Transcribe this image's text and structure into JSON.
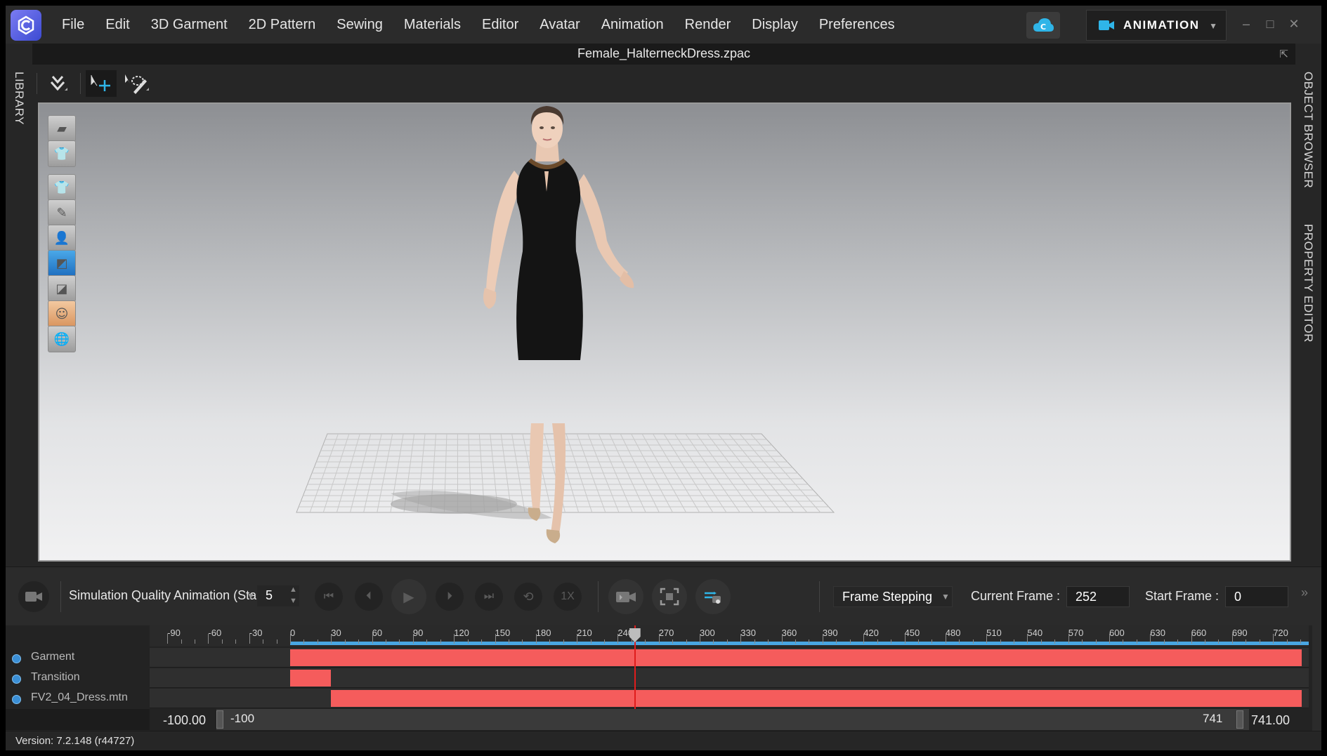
{
  "app": {
    "logo_icon": "clo-logo-icon"
  },
  "menu": [
    "File",
    "Edit",
    "3D Garment",
    "2D Pattern",
    "Sewing",
    "Materials",
    "Editor",
    "Avatar",
    "Animation",
    "Render",
    "Display",
    "Preferences"
  ],
  "mode": {
    "label": "ANIMATION",
    "icon": "video-camera-icon"
  },
  "window": {
    "minimize": "–",
    "maximize": "□",
    "close": "✕"
  },
  "file_title": "Female_HalterneckDress.zpac",
  "side_panels": {
    "left": "LIBRARY",
    "right_top": "OBJECT BROWSER",
    "right_bottom": "PROPERTY EDITOR"
  },
  "toolbar": [
    "import-arrow-icon",
    "select-move-icon",
    "lasso-select-icon"
  ],
  "viewport_tools": [
    "show-3d-garment-icon",
    "show-avatar-garment-icon",
    "show-garment-icon",
    "show-stitch-icon",
    "show-avatar-icon",
    "thickness-icon",
    "texture-icon",
    "avatar-skin-icon",
    "environment-globe-icon"
  ],
  "animation_bar": {
    "sim_quality": "Simulation Quality Animation (Stable",
    "steps_value": "5",
    "frame_mode": "Frame Stepping",
    "current_frame_label": "Current Frame :",
    "current_frame_value": "252",
    "start_frame_label": "Start Frame :",
    "start_frame_value": "0",
    "speed_label": "1X",
    "more": "»"
  },
  "timeline": {
    "ruler_labels": [
      "-90",
      "-60",
      "-30",
      "0",
      "30",
      "60",
      "90",
      "120",
      "150",
      "180",
      "210",
      "240",
      "270",
      "300",
      "330",
      "360",
      "390",
      "420",
      "450",
      "480",
      "510",
      "540",
      "570",
      "600",
      "630",
      "660",
      "690",
      "720"
    ],
    "current_frame": 252,
    "tracks": [
      {
        "name": "Garment",
        "start": 0,
        "end": 741
      },
      {
        "name": "Transition",
        "start": 0,
        "end": 30
      },
      {
        "name": "FV2_04_Dress.mtn",
        "start": 30,
        "end": 741
      }
    ],
    "range_start_display": "-100.00",
    "range_start_inner": "-100",
    "range_end_inner": "741",
    "range_end_display": "741.00"
  },
  "status": {
    "version": "Version: 7.2.148 (r44727)"
  },
  "colors": {
    "clip": "#f55c5c",
    "playhead": "#e01c1c",
    "ruler_active": "#49a6e2",
    "accent": "#2fb5e8"
  }
}
